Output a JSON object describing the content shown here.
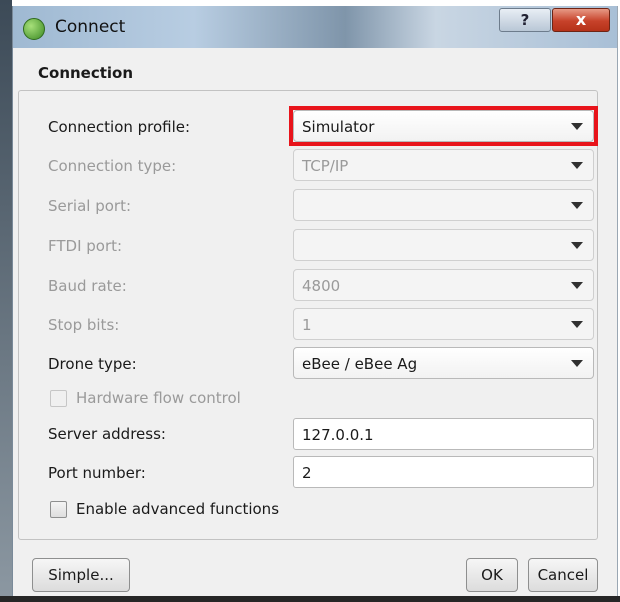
{
  "window": {
    "title": "Connect",
    "help_label": "?",
    "close_label": "x"
  },
  "group": {
    "title": "Connection"
  },
  "fields": {
    "connection_profile": {
      "label": "Connection profile:",
      "value": "Simulator"
    },
    "connection_type": {
      "label": "Connection type:",
      "value": "TCP/IP"
    },
    "serial_port": {
      "label": "Serial port:",
      "value": ""
    },
    "ftdi_port": {
      "label": "FTDI port:",
      "value": ""
    },
    "baud_rate": {
      "label": "Baud rate:",
      "value": "4800"
    },
    "stop_bits": {
      "label": "Stop bits:",
      "value": "1"
    },
    "drone_type": {
      "label": "Drone type:",
      "value": "eBee / eBee Ag"
    },
    "hardware_flow_control": {
      "label": "Hardware flow control",
      "checked": false
    },
    "server_address": {
      "label": "Server address:",
      "value": "127.0.0.1"
    },
    "port_number": {
      "label": "Port number:",
      "value": "2"
    },
    "enable_advanced": {
      "label": "Enable advanced functions",
      "checked": false
    }
  },
  "buttons": {
    "simple": "Simple...",
    "ok": "OK",
    "cancel": "Cancel"
  },
  "colors": {
    "highlight": "#e8141b",
    "close_button": "#c7422a"
  }
}
